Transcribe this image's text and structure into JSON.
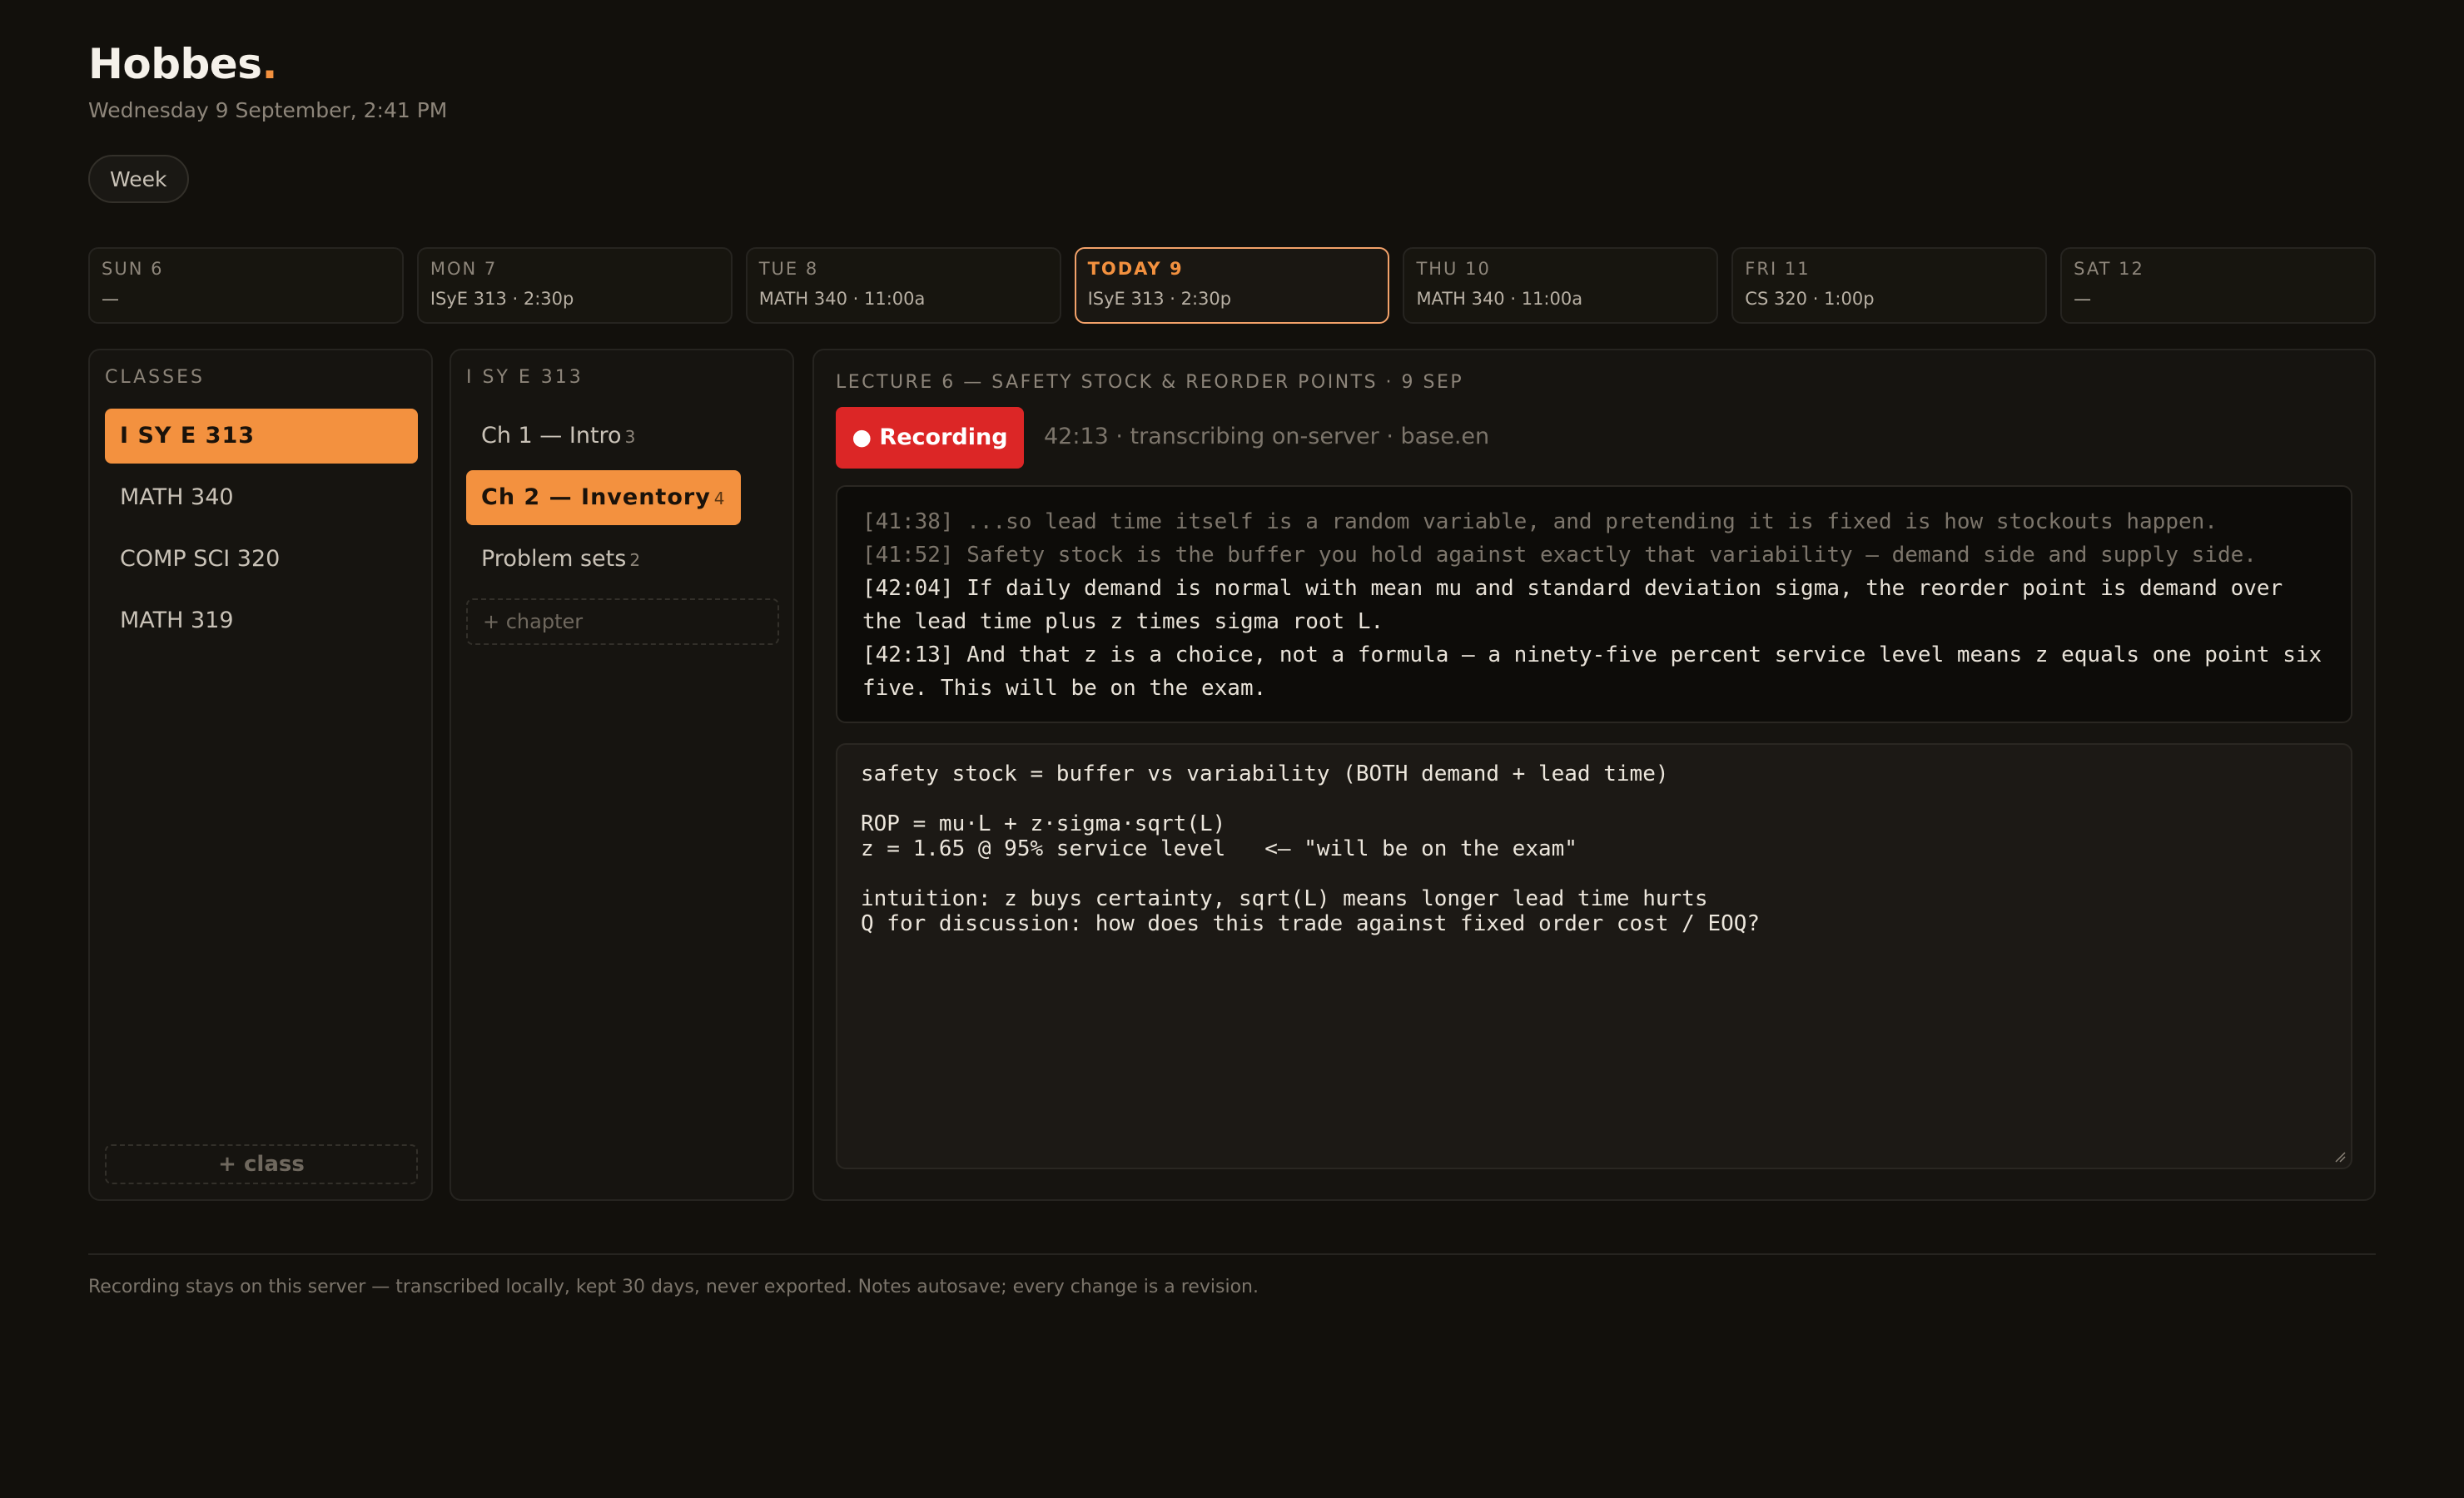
{
  "app": {
    "name": "Hobbes",
    "name_dot": ".",
    "datetime": "Wednesday 9 September, 2:41 PM",
    "view_toggle": "Week"
  },
  "week": [
    {
      "label": "SUN 6",
      "event": "—"
    },
    {
      "label": "MON 7",
      "event": "ISyE 313 · 2:30p"
    },
    {
      "label": "TUE 8",
      "event": "MATH 340 · 11:00a"
    },
    {
      "label": "TODAY 9",
      "event": "ISyE 313 · 2:30p"
    },
    {
      "label": "THU 10",
      "event": "MATH 340 · 11:00a"
    },
    {
      "label": "FRI 11",
      "event": "CS 320 · 1:00p"
    },
    {
      "label": "SAT 12",
      "event": "—"
    }
  ],
  "classes": {
    "title": "CLASSES",
    "items": [
      "I SY E 313",
      "MATH 340",
      "COMP SCI 320",
      "MATH 319"
    ],
    "add_label": "+ class"
  },
  "chapters": {
    "title": "I SY E 313",
    "items": [
      {
        "label": "Ch 1 — Intro",
        "count": "3"
      },
      {
        "label": "Ch 2 — Inventory",
        "count": "4"
      },
      {
        "label": "Problem sets",
        "count": "2"
      }
    ],
    "add_label": "+ chapter"
  },
  "lecture": {
    "title": "LECTURE 6 — SAFETY STOCK & REORDER POINTS · 9 SEP",
    "record_label": "● Recording",
    "record_status": "42:13 · transcribing on-server · base.en",
    "transcript": [
      "[41:38] ...so lead time itself is a random variable, and pretending it is fixed is how stockouts happen.",
      "[41:52] Safety stock is the buffer you hold against exactly that variability — demand side and supply side.",
      "[42:04] If daily demand is normal with mean mu and standard deviation sigma, the reorder point is demand over the lead time plus z times sigma root L.",
      "[42:13] And that z is a choice, not a formula — a ninety-five percent service level means z equals one point six five. This will be on the exam."
    ],
    "notes": "safety stock = buffer vs variability (BOTH demand + lead time)\n\nROP = mu·L + z·sigma·sqrt(L)\nz = 1.65 @ 95% service level   <— \"will be on the exam\"\n\nintuition: z buys certainty, sqrt(L) means longer lead time hurts\nQ for discussion: how does this trade against fixed order cost / EOQ?"
  },
  "footer": "Recording stays on this server — transcribed locally, kept 30 days, never exported. Notes autosave; every change is a revision.",
  "colors": {
    "accent": "#f3913f",
    "recording": "#dc2626",
    "background": "#12100c"
  }
}
